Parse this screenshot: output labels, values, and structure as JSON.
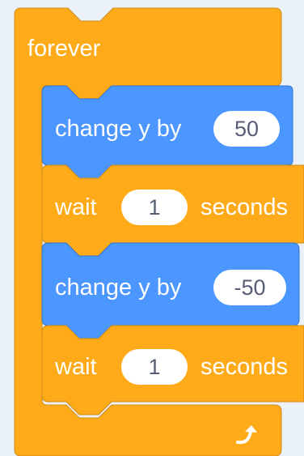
{
  "colors": {
    "control": "#ffab19",
    "control_stroke": "#cf8b17",
    "motion": "#4c97ff",
    "motion_stroke": "#3373cc",
    "background": "#eaf1f9"
  },
  "forever_block": {
    "label": "forever",
    "loop_icon": "loop-arrow-icon",
    "children": [
      {
        "type": "motion",
        "label": "change y by",
        "value": "50"
      },
      {
        "type": "control",
        "label": "wait",
        "value": "1",
        "suffix": "seconds"
      },
      {
        "type": "motion",
        "label": "change y by",
        "value": "-50"
      },
      {
        "type": "control",
        "label": "wait",
        "value": "1",
        "suffix": "seconds"
      }
    ]
  }
}
